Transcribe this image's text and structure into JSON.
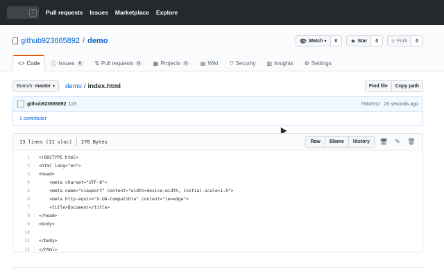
{
  "topnav": {
    "search_key": "/",
    "items": [
      "Pull requests",
      "Issues",
      "Marketplace",
      "Explore"
    ]
  },
  "repo": {
    "owner": "github923665892",
    "separator": "/",
    "name": "demo"
  },
  "actions": {
    "watch": {
      "label": "Watch",
      "count": "0"
    },
    "star": {
      "label": "Star",
      "count": "0"
    },
    "fork": {
      "label": "Fork",
      "count": "0"
    }
  },
  "tabs": [
    {
      "label": "Code",
      "icon": "<>",
      "counter": ""
    },
    {
      "label": "Issues",
      "icon": "ⓘ",
      "counter": "0"
    },
    {
      "label": "Pull requests",
      "icon": "⇅",
      "counter": "0"
    },
    {
      "label": "Projects",
      "icon": "▦",
      "counter": "0"
    },
    {
      "label": "Wiki",
      "icon": "▤",
      "counter": ""
    },
    {
      "label": "Security",
      "icon": "⛉",
      "counter": ""
    },
    {
      "label": "Insights",
      "icon": "▥",
      "counter": ""
    },
    {
      "label": "Settings",
      "icon": "⚙",
      "counter": ""
    }
  ],
  "filebar": {
    "branch_prefix": "Branch:",
    "branch": "master",
    "repo_link": "demo",
    "sep": "/",
    "file": "index.html",
    "find_file": "Find file",
    "copy_path": "Copy path"
  },
  "commit": {
    "author": "github923665892",
    "message": "123",
    "sha": "f68d532",
    "ago": "20 seconds ago",
    "contributors": "1 contributor"
  },
  "file": {
    "lines_info": "13 lines (11 sloc)",
    "size": "276 Bytes",
    "raw": "Raw",
    "blame": "Blame",
    "history": "History"
  },
  "code_lines": [
    {
      "n": "1",
      "text": "<!DOCTYPE html>"
    },
    {
      "n": "2",
      "text": "<html lang=\"en\">"
    },
    {
      "n": "3",
      "text": "<head>"
    },
    {
      "n": "4",
      "text": "    <meta charset=\"UTF-8\">"
    },
    {
      "n": "5",
      "text": "    <meta name=\"viewport\" content=\"width=device-width, initial-scale=1.0\">"
    },
    {
      "n": "6",
      "text": "    <meta http-equiv=\"X-UA-Compatible\" content=\"ie=edge\">"
    },
    {
      "n": "7",
      "text": "    <title>Document</title>"
    },
    {
      "n": "8",
      "text": "</head>"
    },
    {
      "n": "9",
      "text": "<body>"
    },
    {
      "n": "10",
      "text": ""
    },
    {
      "n": "11",
      "text": "</body>"
    },
    {
      "n": "12",
      "text": "</html>"
    }
  ]
}
